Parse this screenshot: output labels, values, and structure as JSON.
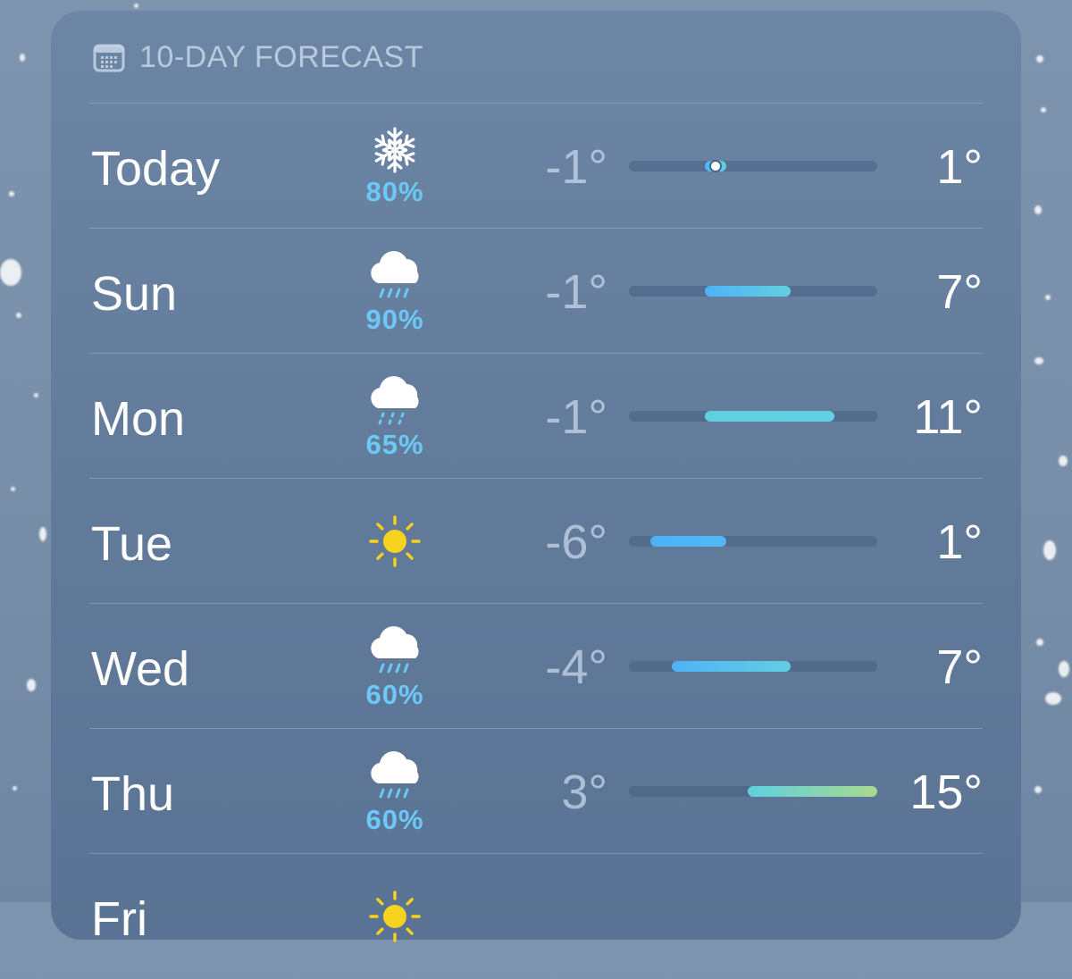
{
  "header": {
    "icon": "calendar-icon",
    "title": "10-DAY FORECAST"
  },
  "days": [
    {
      "day": "Today",
      "icon": "snowflake",
      "precip": "80%",
      "low": "-1°",
      "high": "1°",
      "low_value": -1,
      "high_value": 1,
      "current_value": 0
    },
    {
      "day": "Sun",
      "icon": "cloud-rain",
      "precip": "90%",
      "low": "-1°",
      "high": "7°",
      "low_value": -1,
      "high_value": 7
    },
    {
      "day": "Mon",
      "icon": "cloud-drizzle",
      "precip": "65%",
      "low": "-1°",
      "high": "11°",
      "low_value": -1,
      "high_value": 11
    },
    {
      "day": "Tue",
      "icon": "sun",
      "precip": "",
      "low": "-6°",
      "high": "1°",
      "low_value": -6,
      "high_value": 1
    },
    {
      "day": "Wed",
      "icon": "cloud-rain",
      "precip": "60%",
      "low": "-4°",
      "high": "7°",
      "low_value": -4,
      "high_value": 7
    },
    {
      "day": "Thu",
      "icon": "cloud-rain",
      "precip": "60%",
      "low": "3°",
      "high": "15°",
      "low_value": 3,
      "high_value": 15
    },
    {
      "day": "Fri",
      "icon": "sun",
      "precip": "",
      "low": "",
      "high": "",
      "low_value": null,
      "high_value": null
    }
  ],
  "temp_range": {
    "min": -8,
    "max": 15
  },
  "colors": {
    "precip": "#6cc8f6",
    "sun": "#f7d21e",
    "bar_cold": "#4fb2f7",
    "bar_mild": "#5fd0e0",
    "bar_warm": "#a8d98f"
  }
}
